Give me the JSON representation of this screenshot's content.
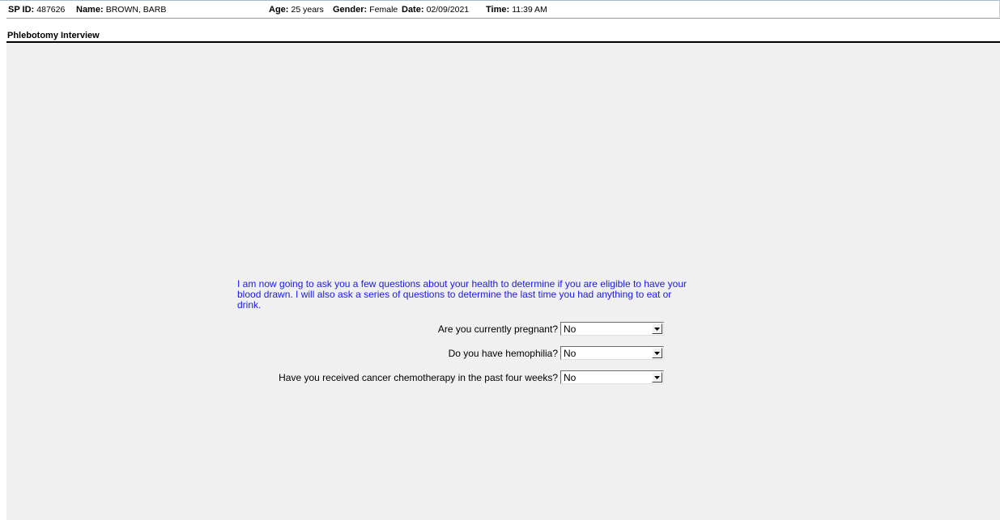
{
  "header": {
    "sp_id_label": "SP ID:",
    "sp_id_value": "487626",
    "name_label": "Name:",
    "name_value": "BROWN, BARB",
    "age_label": "Age:",
    "age_value": "25 years",
    "gender_label": "Gender:",
    "gender_value": "Female",
    "date_label": "Date:",
    "date_value": "02/09/2021",
    "time_label": "Time:",
    "time_value": "11:39 AM"
  },
  "form": {
    "title": "Phlebotomy Interview",
    "intro": "I am now going to ask you a few questions about your health to determine if you are eligible to have your blood drawn. I will also ask a series of questions to determine the last time you had anything to eat or drink.",
    "questions": [
      {
        "label": "Are you currently pregnant?",
        "value": "No"
      },
      {
        "label": "Do you have hemophilia?",
        "value": "No"
      },
      {
        "label": "Have you received cancer chemotherapy in the past four weeks?",
        "value": "No"
      }
    ]
  },
  "icons": {
    "dropdown": "chevron-down-icon"
  },
  "colors": {
    "background": "#f0f0f0",
    "intro_text": "#1a1ae6"
  }
}
